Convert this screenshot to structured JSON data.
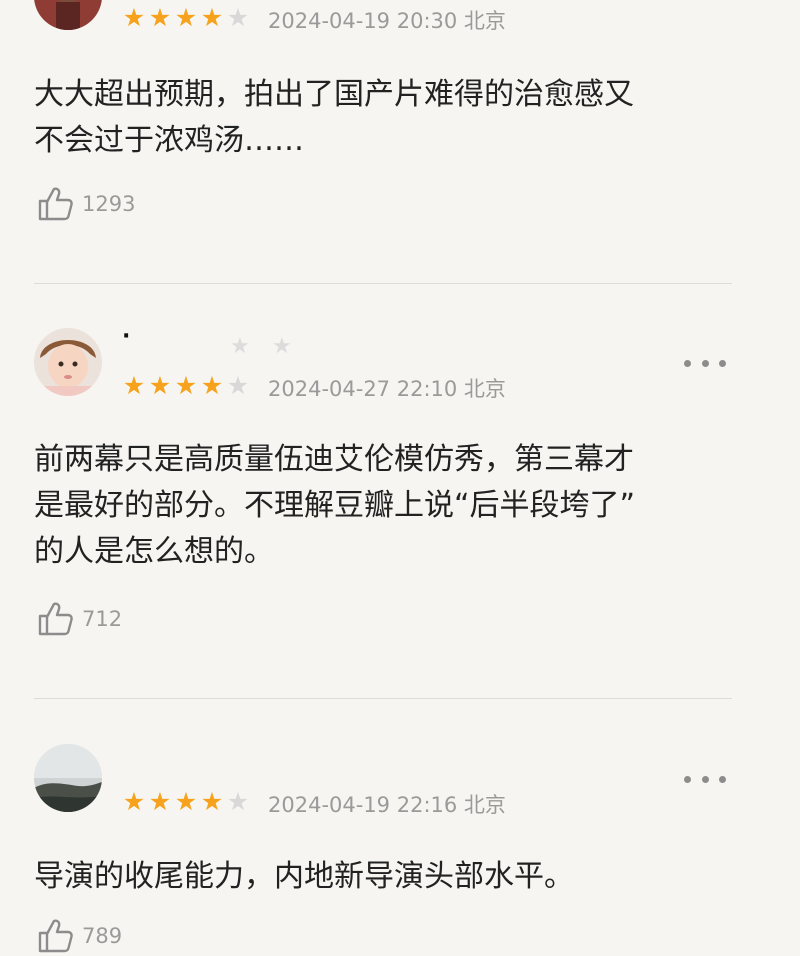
{
  "comments": [
    {
      "username": "",
      "rating": 4,
      "date": "2024-04-19 20:30 北京",
      "text": "大大超出预期，拍出了国产片难得的治愈感又\n不会过于浓鸡汤……",
      "likes": "1293",
      "more_icon": "more-dots-icon"
    },
    {
      "username": "·",
      "rating": 4,
      "date": "2024-04-27 22:10 北京",
      "text": "前两幕只是高质量伍迪艾伦模仿秀，第三幕才\n是最好的部分。不理解豆瓣上说“后半段垮了”\n的人是怎么想的。",
      "likes": "712",
      "more_icon": "more-dots-icon"
    },
    {
      "username": "",
      "rating": 4,
      "date": "2024-04-19 22:16 北京",
      "text": "导演的收尾能力，内地新导演头部水平。",
      "likes": "789",
      "more_icon": "more-dots-icon"
    }
  ],
  "colors": {
    "star_on": "#f7a21d",
    "star_off": "#d8d8d8",
    "meta_text": "#9a9a9a",
    "body_text": "#222222",
    "background": "#f6f5f1"
  }
}
